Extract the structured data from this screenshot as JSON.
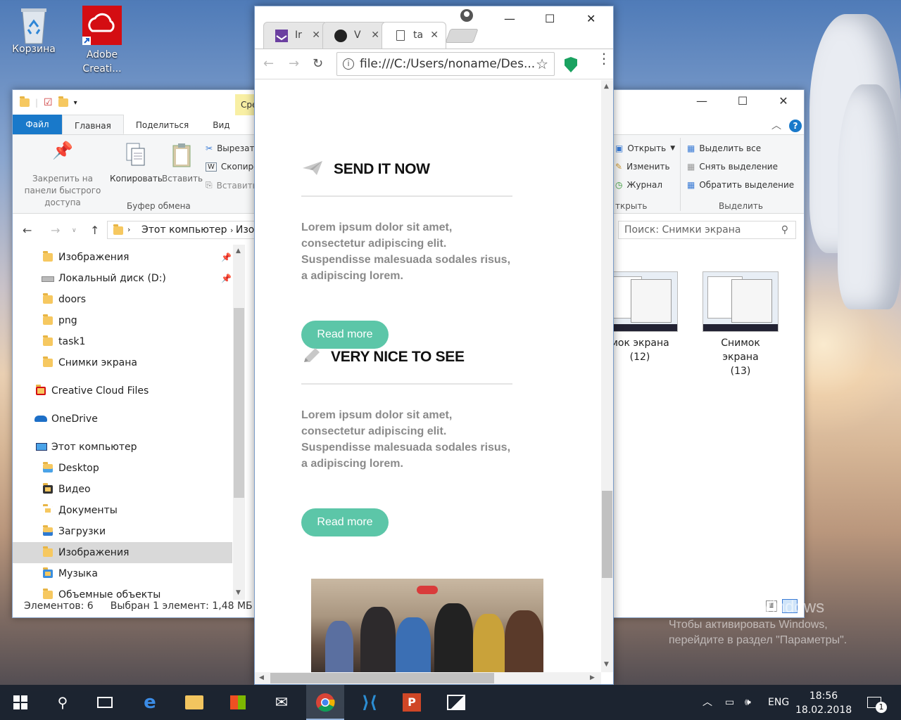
{
  "desktop": {
    "icons": [
      {
        "label": "Корзина",
        "icon": "recycle-bin-icon"
      },
      {
        "label": "Adobe Creati...",
        "icon": "adobe-cc-icon"
      }
    ],
    "activation": {
      "title": "Активация Windows",
      "line1": "Чтобы активировать Windows,",
      "line2": "перейдите в раздел \"Параметры\"."
    }
  },
  "explorer": {
    "context_tab": "Сре",
    "tabs": [
      "Файл",
      "Главная",
      "Поделиться",
      "Вид"
    ],
    "ribbon": {
      "pin_label": "Закрепить на панели быстрого доступа",
      "copy": "Копировать",
      "paste": "Вставить",
      "cut": "Вырезать",
      "copy_path": "Скопиро",
      "paste_shortcut": "Вставить",
      "clipboard_group": "Буфер обмена",
      "open": "Открыть",
      "edit": "Изменить",
      "history": "Журнал",
      "open_group": "ткрыть",
      "select_all": "Выделить все",
      "select_none": "Снять выделение",
      "invert": "Обратить выделение",
      "select_group": "Выделить"
    },
    "address": {
      "part1": "Этот компьютер",
      "part2": "Изо"
    },
    "search_placeholder": "Поиск: Снимки экрана",
    "tree": [
      {
        "label": "Изображения",
        "pinned": true
      },
      {
        "label": "Локальный диск (D:)",
        "pinned": true
      },
      {
        "label": "doors"
      },
      {
        "label": "png"
      },
      {
        "label": "task1"
      },
      {
        "label": "Снимки экрана"
      },
      {
        "label": "Creative Cloud Files"
      },
      {
        "label": "OneDrive"
      },
      {
        "label": "Этот компьютер"
      },
      {
        "label": "Desktop"
      },
      {
        "label": "Видео"
      },
      {
        "label": "Документы"
      },
      {
        "label": "Загрузки"
      },
      {
        "label": "Изображения",
        "selected": true
      },
      {
        "label": "Музыка"
      },
      {
        "label": "Объемные объекты"
      }
    ],
    "files": [
      {
        "name": "мок экрана",
        "sub": "(12)"
      },
      {
        "name": "Снимок экрана",
        "sub": "(13)"
      }
    ],
    "status": {
      "count": "Элементов: 6",
      "selected": "Выбран 1 элемент: 1,48 МБ"
    }
  },
  "chrome": {
    "tabs": [
      {
        "title": "Ir",
        "icon": "mail-icon"
      },
      {
        "title": "V",
        "icon": "github-icon"
      },
      {
        "title": "ta",
        "icon": "page-icon",
        "active": true
      }
    ],
    "url": "file:///C:/Users/noname/Des...",
    "sections": [
      {
        "title": "SEND IT NOW",
        "icon": "paper-plane-icon",
        "text": "Lorem ipsum dolor sit amet, consectetur adipiscing elit. Suspendisse malesuada sodales risus, a adipiscing lorem.",
        "button": "Read more"
      },
      {
        "title": "VERY NICE TO SEE",
        "icon": "pencil-icon",
        "text": "Lorem ipsum dolor sit amet, consectetur adipiscing elit. Suspendisse malesuada sodales risus, a adipiscing lorem.",
        "button": "Read more"
      }
    ]
  },
  "taskbar": {
    "language": "ENG",
    "time": "18:56",
    "date": "18.02.2018",
    "notifications": "1"
  },
  "colors": {
    "accent": "#5cc6a8",
    "explorer_file_tab": "#1979ca",
    "taskbar": "#1c2430"
  }
}
